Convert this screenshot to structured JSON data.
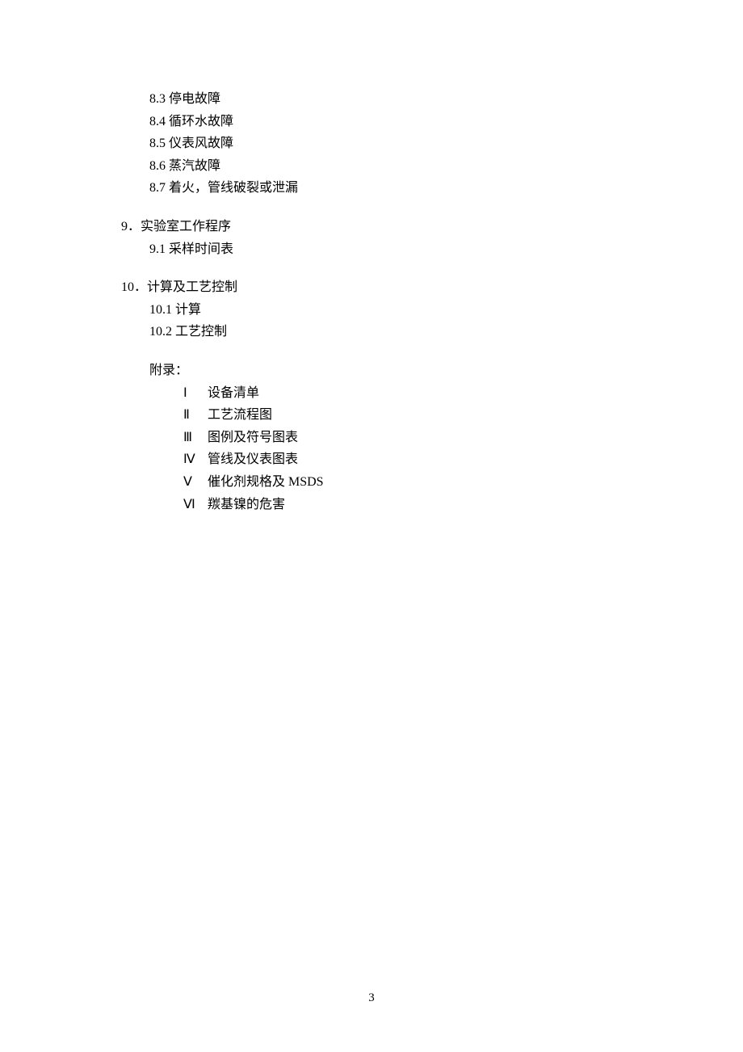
{
  "section8": {
    "items": [
      {
        "num": "8.3",
        "label": "停电故障"
      },
      {
        "num": "8.4",
        "label": "循环水故障"
      },
      {
        "num": "8.5",
        "label": "仪表风故障"
      },
      {
        "num": "8.6",
        "label": "蒸汽故障"
      },
      {
        "num": "8.7",
        "label": "着火，管线破裂或泄漏"
      }
    ]
  },
  "section9": {
    "header": "9．实验室工作程序",
    "items": [
      {
        "num": "9.1",
        "label": "采样时间表"
      }
    ]
  },
  "section10": {
    "header": "10．计算及工艺控制",
    "items": [
      {
        "num": "10.1",
        "label": "计算"
      },
      {
        "num": "10.2",
        "label": "工艺控制"
      }
    ]
  },
  "appendix": {
    "header": "附录：",
    "items": [
      {
        "roman": "Ⅰ",
        "label": "设备清单"
      },
      {
        "roman": "Ⅱ",
        "label": "工艺流程图"
      },
      {
        "roman": "Ⅲ",
        "label": "图例及符号图表"
      },
      {
        "roman": "Ⅳ",
        "label": "管线及仪表图表"
      },
      {
        "roman": "Ⅴ",
        "label": "催化剂规格及 MSDS"
      },
      {
        "roman": "Ⅵ",
        "label": "羰基镍的危害"
      }
    ]
  },
  "pageNumber": "3"
}
